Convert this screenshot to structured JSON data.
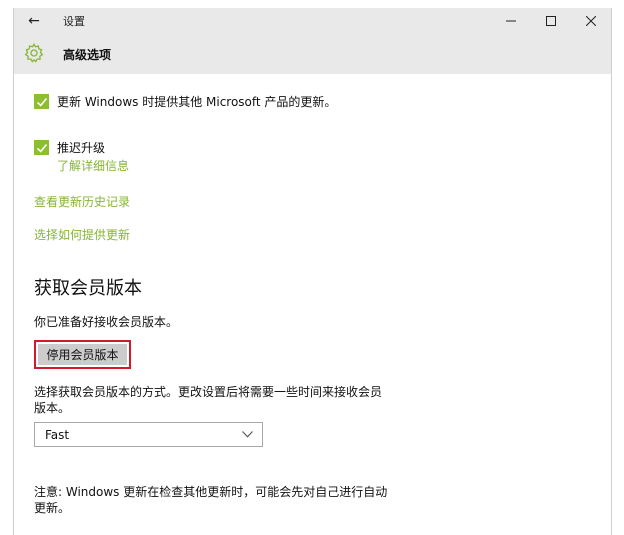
{
  "window": {
    "app_title": "设置",
    "back_glyph": "←",
    "controls": {
      "minimize": "minimize-icon",
      "maximize": "maximize-icon",
      "close": "close-icon"
    }
  },
  "header": {
    "icon": "gear-icon",
    "title": "高级选项"
  },
  "options": {
    "office_updates": {
      "checked": true,
      "label": "更新 Windows 时提供其他 Microsoft 产品的更新。"
    },
    "defer_upgrades": {
      "checked": true,
      "label": "推迟升级",
      "learn_more": "了解详细信息"
    },
    "view_history_link": "查看更新历史记录",
    "choose_delivery_link": "选择如何提供更新"
  },
  "insider": {
    "heading": "获取会员版本",
    "ready_text": "你已准备好接收会员版本。",
    "stop_button": "停用会员版本",
    "pace_description_line1": "选择获取会员版本的方式。更改设置后将需要一些时间来接收会员",
    "pace_description_line2": "版本。",
    "pace_select": {
      "value": "Fast",
      "icon": "chevron-down-icon"
    },
    "note_line1": "注意: Windows 更新在检查其他更新时，可能会先对自己进行自动",
    "note_line2": "更新。"
  },
  "colors": {
    "accent": "#8cbe2f",
    "link": "#86b631",
    "highlight_border": "#d11a2a",
    "chrome_bg": "#e9e9e9"
  }
}
